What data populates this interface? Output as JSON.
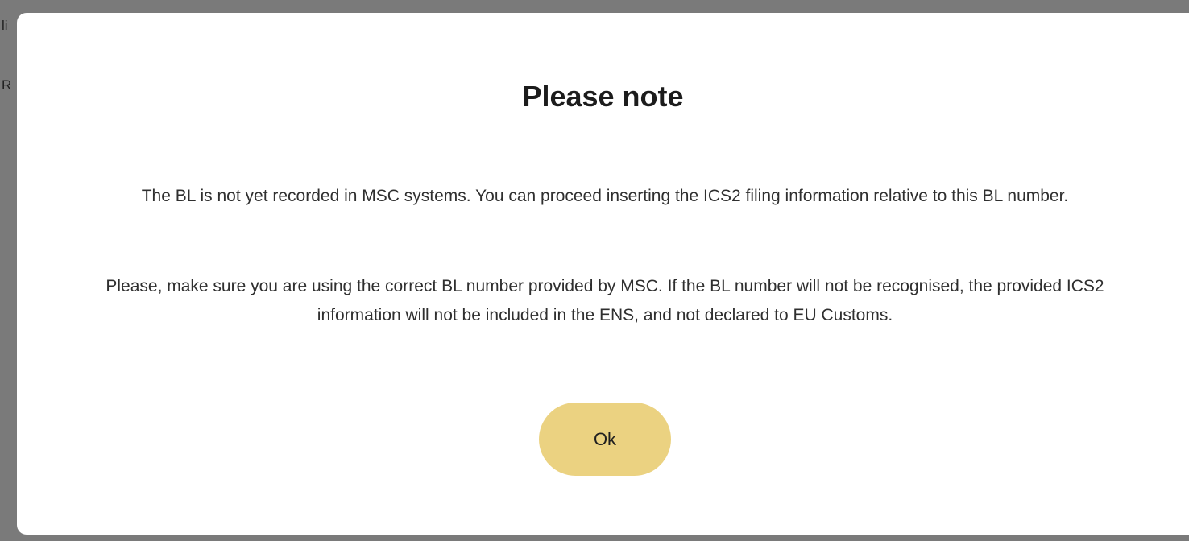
{
  "background": {
    "peek_line_1": "li",
    "peek_line_2": "R:"
  },
  "dialog": {
    "title": "Please note",
    "paragraph_1": "The BL is not yet recorded in MSC systems. You can proceed inserting the ICS2 filing information relative to this BL number.",
    "paragraph_2": "Please, make sure you are using the correct BL number provided by MSC. If the BL number will not be recognised, the provided ICS2 information will not be included in the ENS, and not declared to EU Customs.",
    "ok_label": "Ok"
  },
  "colors": {
    "overlay": "#7a7a7a",
    "dialog_bg": "#ffffff",
    "button_bg": "#ebd281",
    "text": "#2f2f2f"
  }
}
